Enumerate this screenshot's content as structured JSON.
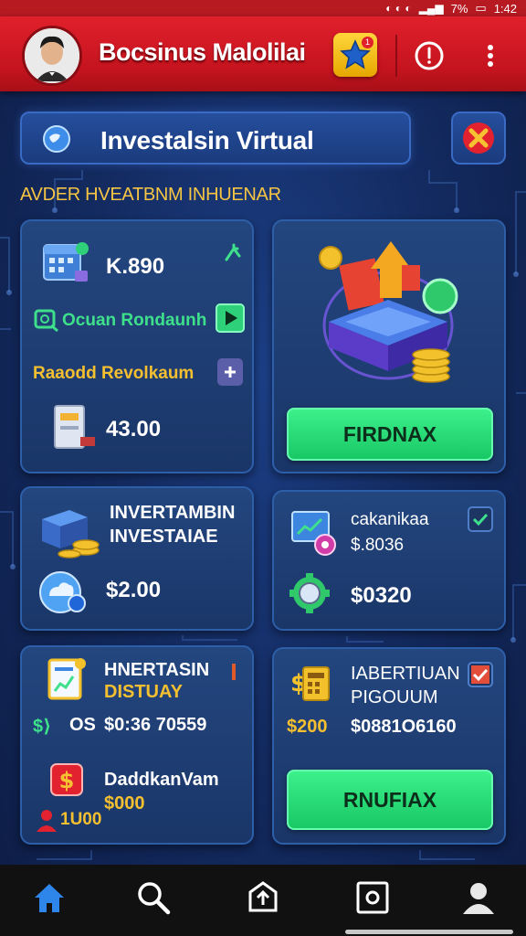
{
  "status_bar": {
    "battery": "7%",
    "time": "1:42"
  },
  "header": {
    "title": "Bocsinus Malolilai",
    "badge_count": "1"
  },
  "search": {
    "title": "Investalsin Virtual"
  },
  "section_title": "AVDER HVEATBNM INHUENAR",
  "cards": {
    "card1": {
      "value1": "K.890",
      "label_green": "Ocuan Rondaunh",
      "label_yellow": "Raaodd Revolkaum",
      "value2": "43.00"
    },
    "card2": {
      "button": "FIRDNAX"
    },
    "card3": {
      "title_line1": "INVERTAMBIN",
      "title_line2": "INVESTAIAE",
      "value": "$2.00"
    },
    "card4": {
      "title": "cakanikaa",
      "value1": "$.8036",
      "value2": "$0320"
    },
    "card5": {
      "title_line1": "HNERTASIN",
      "title_line2": "DISTUAY",
      "code": "OS",
      "value1": "$0:36 70559",
      "title2": "DaddkanVam",
      "value2": "$000",
      "small_value": "1U00"
    },
    "card6": {
      "title_line1": "IABERTIUAN",
      "title_line2": "PIGOUUM",
      "value1": "$200",
      "value2": "$0881O6160",
      "button": "RNUFIAX"
    }
  },
  "colors": {
    "header_red": "#d81b27",
    "accent_green": "#27d873",
    "accent_gold": "#f5c030",
    "bg_navy": "#142c63"
  },
  "nav": [
    "home-icon",
    "search-icon",
    "upload-icon",
    "wallet-icon",
    "profile-icon"
  ]
}
